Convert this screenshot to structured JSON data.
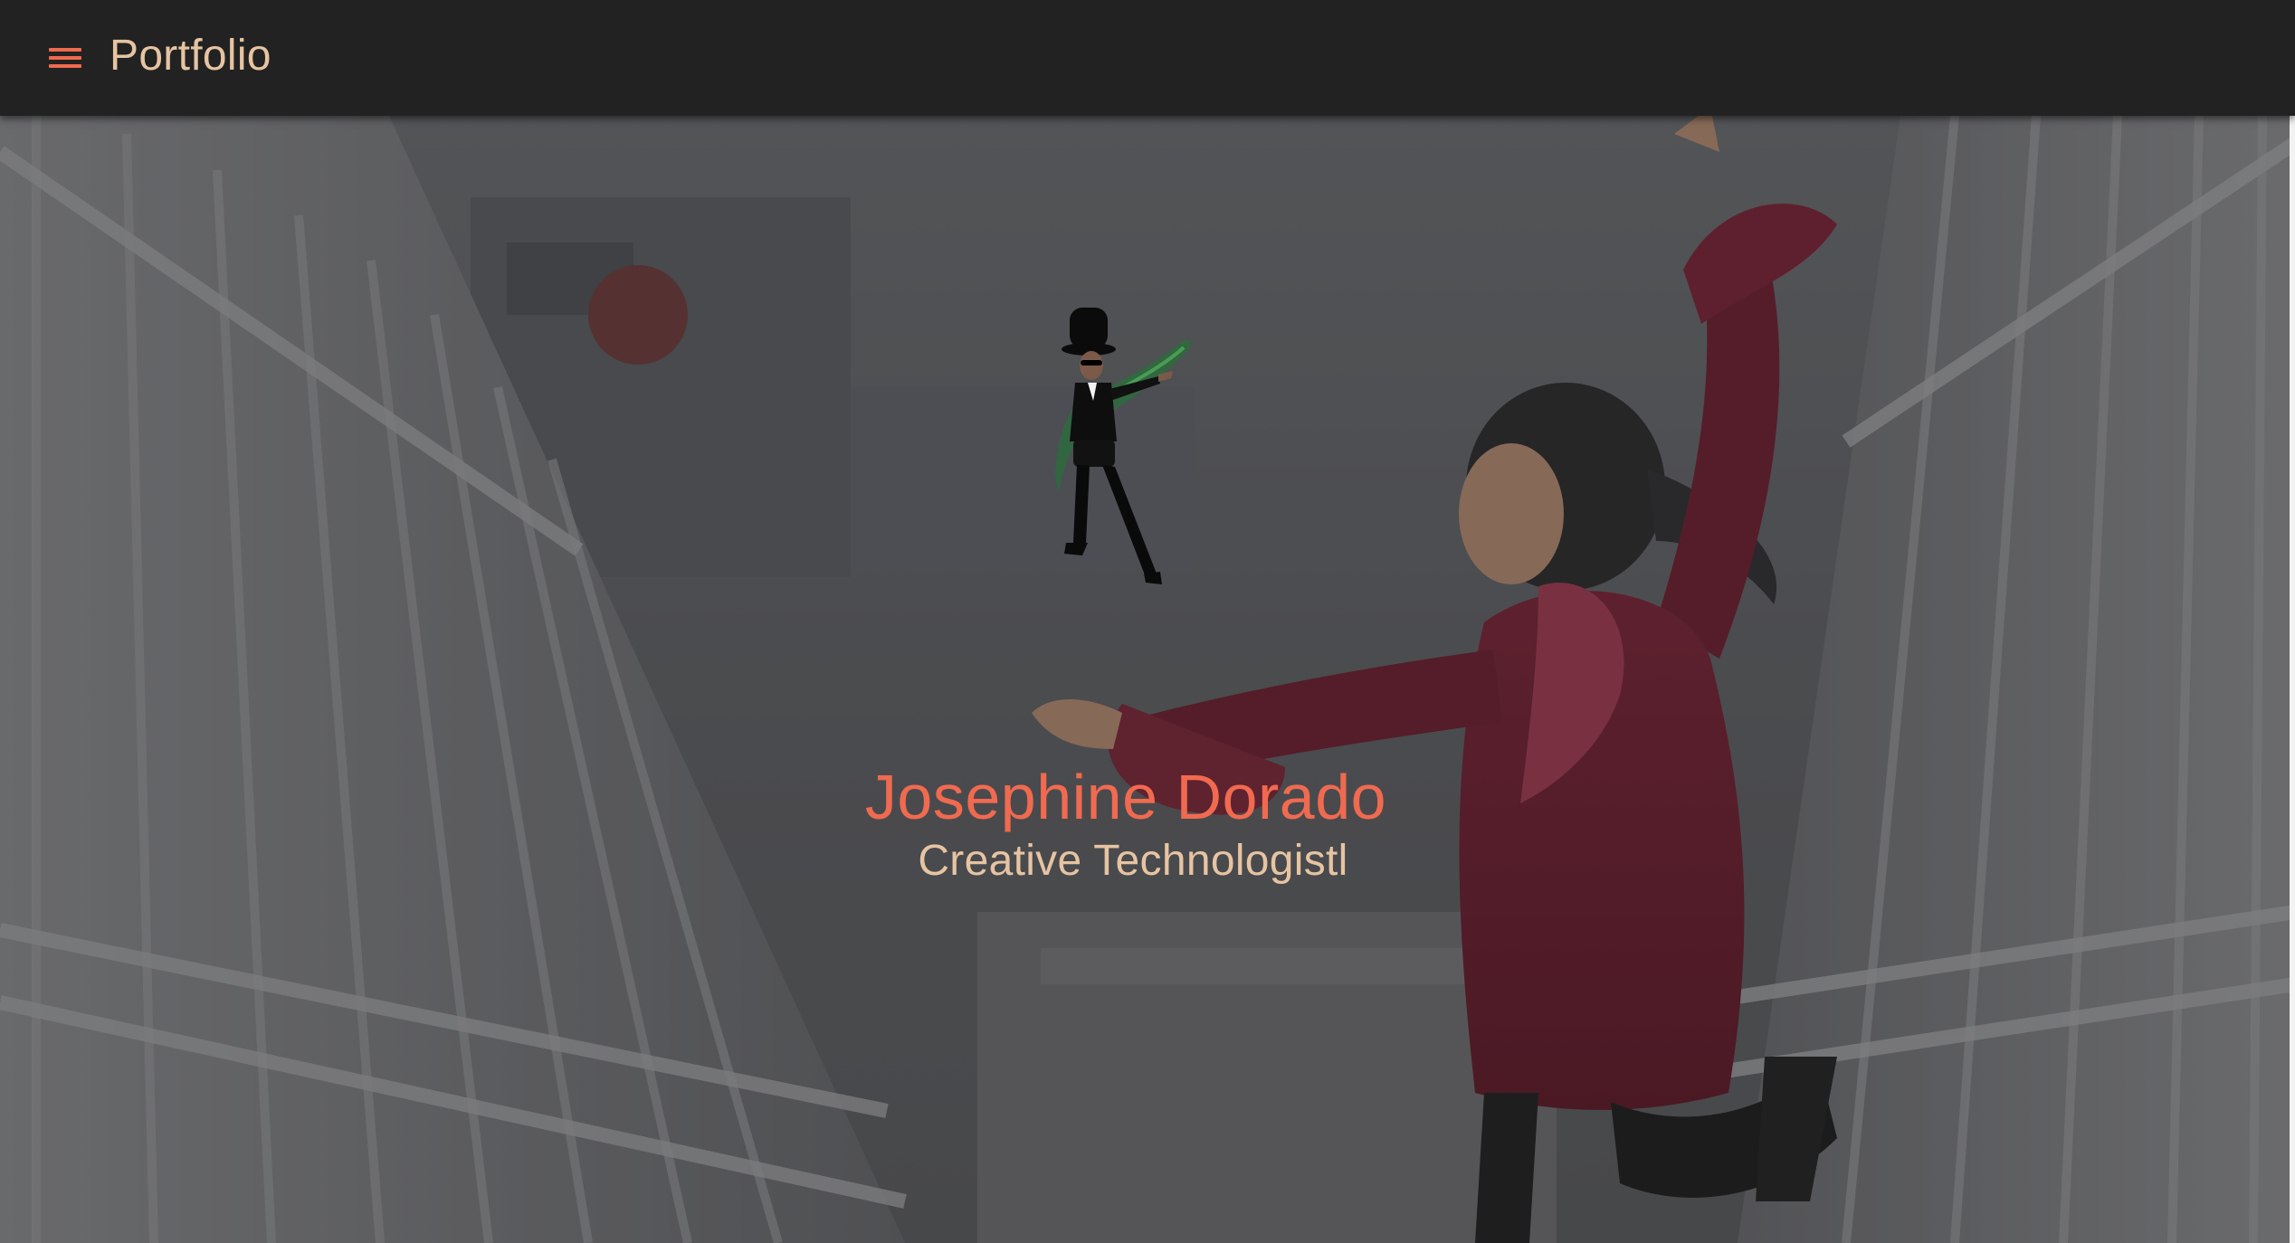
{
  "appbar": {
    "menu_icon": "hamburger-menu-icon",
    "title": "Portfolio",
    "accent_color": "#ef6a4e",
    "title_color": "#e6c4a2"
  },
  "hero": {
    "background_image": "woman-jumping-on-bridge-photo",
    "avatar_image": "top-hat-avatar-figure",
    "name": "Josephine Dorado",
    "role": "Creative Technologistl",
    "name_color": "#f06a50",
    "role_color": "#e6c4a2"
  }
}
